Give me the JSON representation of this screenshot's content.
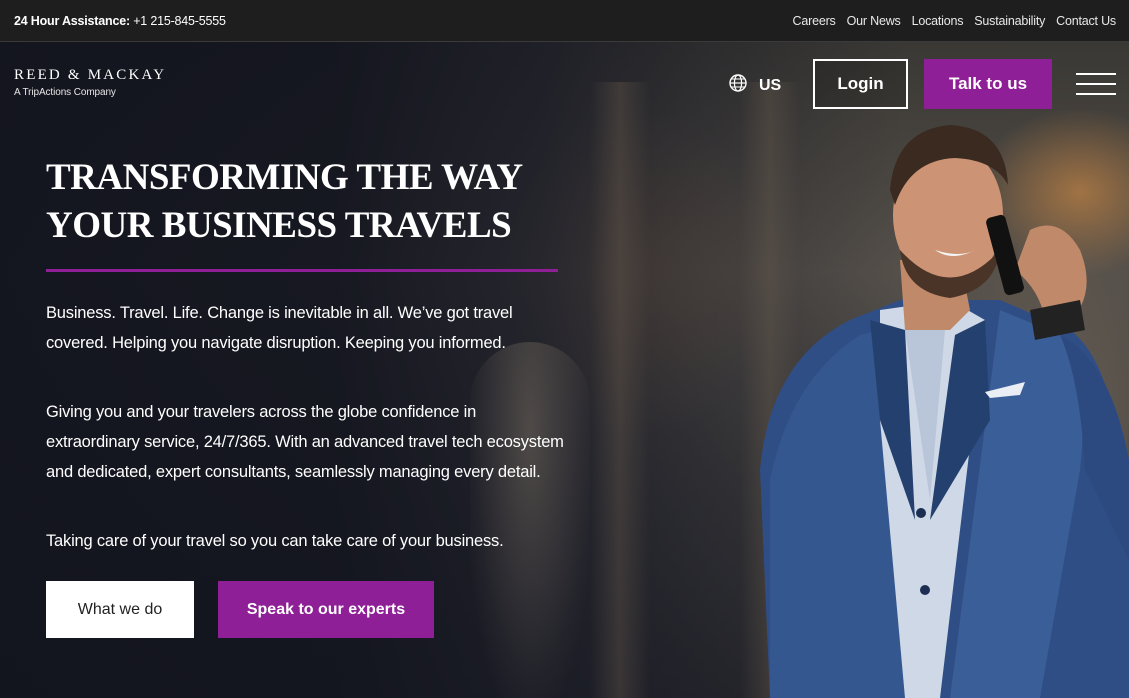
{
  "topbar": {
    "assist_label": "24 Hour Assistance:",
    "assist_phone": "+1 215-845-5555",
    "links": [
      "Careers",
      "Our News",
      "Locations",
      "Sustainability",
      "Contact Us"
    ]
  },
  "header": {
    "logo_name": "REED & MACKAY",
    "logo_sub": "A TripActions Company",
    "locale": "US",
    "login_label": "Login",
    "talk_label": "Talk to us"
  },
  "hero": {
    "headline_line1": "TRANSFORMING THE WAY",
    "headline_line2": "YOUR BUSINESS TRAVELS",
    "paragraphs": [
      "Business. Travel. Life. Change is inevitable in all. We’ve got travel covered. Helping you navigate disruption. Keeping you informed.",
      "Giving you and your travelers across the globe confidence in extraordinary service, 24/7/365. With an advanced travel tech ecosystem and dedicated, expert consultants, seamlessly managing every detail.",
      "Taking care of your travel so you can take care of your business."
    ],
    "cta_primary": "What we do",
    "cta_secondary": "Speak to our experts"
  },
  "colors": {
    "accent": "#8e1f96",
    "topbar_bg": "#1e1e1e"
  },
  "icons": {
    "locale": "globe-icon",
    "menu": "hamburger-menu-icon"
  }
}
